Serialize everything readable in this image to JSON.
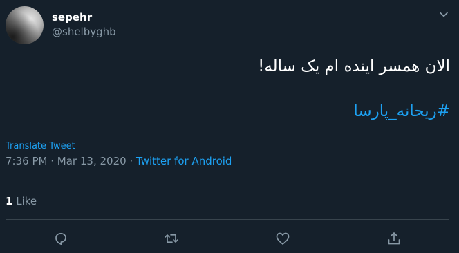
{
  "user": {
    "display_name": "sepehr",
    "handle": "@shelbyghb"
  },
  "tweet": {
    "text": "الان همسر اینده ام یک ساله!",
    "hashtag": "#ریحانه_پارسا",
    "translate_label": "Translate Tweet",
    "time": "7:36 PM",
    "date": "Mar 13, 2020",
    "separator": "·",
    "source": "Twitter for Android"
  },
  "stats": {
    "like_count": "1",
    "like_label": "Like"
  },
  "icons": {
    "caret": "chevron-down-icon",
    "reply": "reply-icon",
    "retweet": "retweet-icon",
    "like": "heart-icon",
    "share": "share-icon"
  },
  "colors": {
    "background": "#15202b",
    "accent": "#1da1f2",
    "secondary_text": "#8899a6",
    "divider": "#38444d"
  }
}
